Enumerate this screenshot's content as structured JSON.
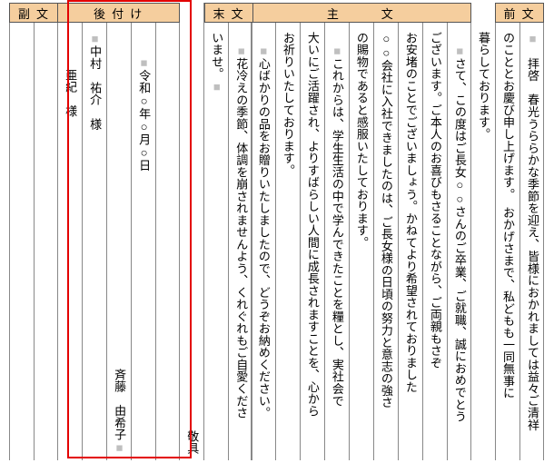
{
  "sections": {
    "zenbun": {
      "label": "前 文"
    },
    "shubun": {
      "label": "主　　　文"
    },
    "matsubun": {
      "label": "末 文"
    },
    "atozuke": {
      "label": "後 付 け"
    },
    "fukubun": {
      "label": "副 文"
    }
  },
  "zen": {
    "c1": "　拝啓　春光うららかな季節を迎え、皆様におかれましては益々ご清祥",
    "c1mk": "■",
    "c2": "のこととお慶び申し上げます。　おかげさまで、私どもも一同無事に",
    "c3": "暮らしております。"
  },
  "shu": {
    "c1": "さて、この度はご長女○○さんのご卒業、ご就職、誠におめでとう",
    "c1mk": "　■",
    "c2": "ございます。ご本人のお喜びもさることながら、ご両親もさぞ",
    "c3": "お安堵のことでございましょう。かねてより希望されておりました",
    "c4": "○○会社に入社できましたのは、ご長女様の日頃の努力と意志の強さ",
    "c5": "の賜物であると感服いたしております。",
    "c6": "これからは、学生生活の中で学んできたことを糧とし、実社会で",
    "c6mk": "　■",
    "c7": "大いにご活躍され、よりすばらしい人間に成長されますことを、心から",
    "c8": "お祈りいたしております。",
    "c9": "心ばかりの品をお贈りいたしましたので、どうぞお納めください。",
    "c9mk": "　■"
  },
  "matsu": {
    "c1": "花冷えの季節、体調を崩されませんよう、くれぐれもご自愛くださ",
    "c1mk": "　■",
    "c2a": "いませ。",
    "c2mk": "■",
    "keigu": "敬具"
  },
  "ato": {
    "date": "令和○年○月○日",
    "datemk": "　　■",
    "sender": "斉藤　由希子",
    "sendermk": "■",
    "recipient1": "中村　祐介　様",
    "recipient1mk": "■",
    "recipient2": "亜紀　様"
  }
}
